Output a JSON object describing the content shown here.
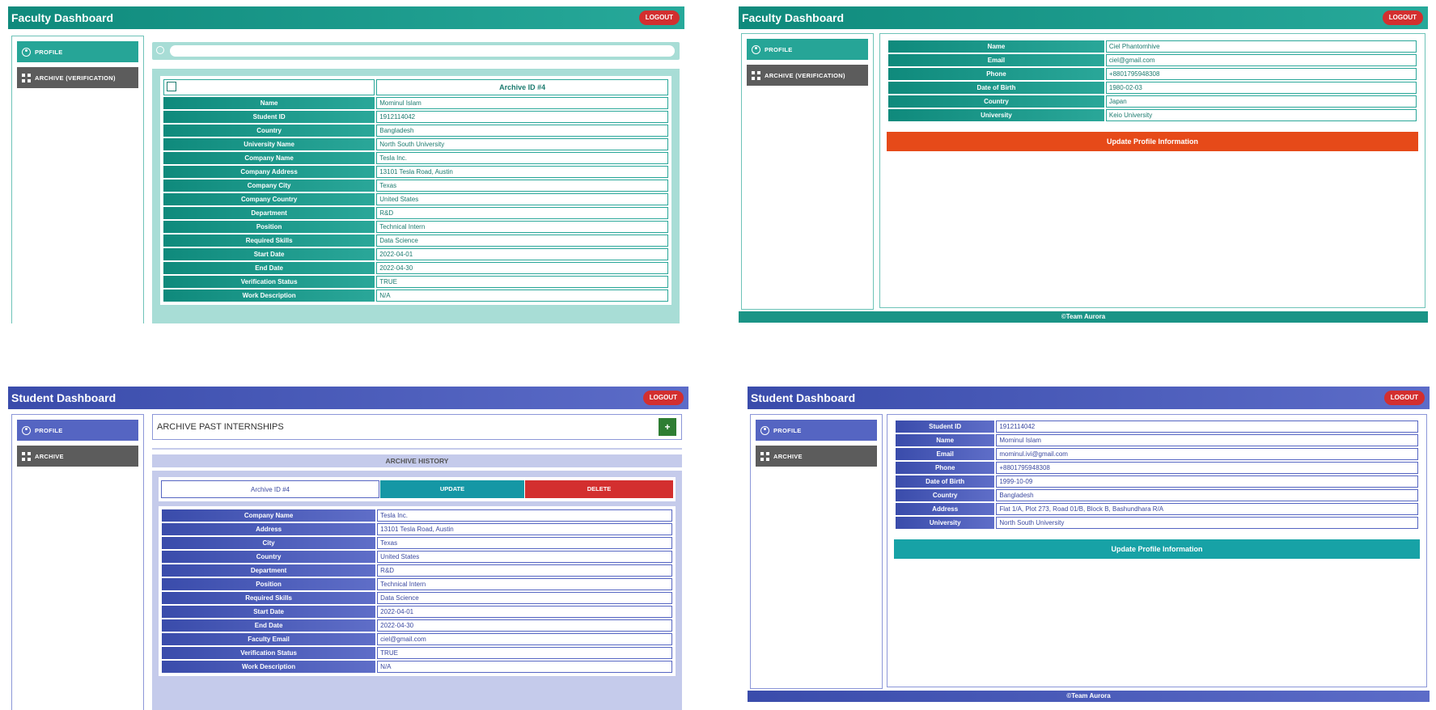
{
  "faculty_archive": {
    "title": "Faculty Dashboard",
    "logout": "LOGOUT",
    "sidebar": {
      "profile": "PROFILE",
      "archive": "ARCHIVE (VERIFICATION)"
    },
    "archive_id": "Archive ID #4",
    "rows": [
      {
        "label": "Name",
        "value": "Mominul Islam"
      },
      {
        "label": "Student ID",
        "value": "1912114042"
      },
      {
        "label": "Country",
        "value": "Bangladesh"
      },
      {
        "label": "University Name",
        "value": "North South University"
      },
      {
        "label": "Company Name",
        "value": "Tesla Inc."
      },
      {
        "label": "Company Address",
        "value": "13101 Tesla Road, Austin"
      },
      {
        "label": "Company City",
        "value": "Texas"
      },
      {
        "label": "Company Country",
        "value": "United States"
      },
      {
        "label": "Department",
        "value": "R&D"
      },
      {
        "label": "Position",
        "value": "Technical Intern"
      },
      {
        "label": "Required Skills",
        "value": "Data Science"
      },
      {
        "label": "Start Date",
        "value": "2022-04-01"
      },
      {
        "label": "End Date",
        "value": "2022-04-30"
      },
      {
        "label": "Verification Status",
        "value": "TRUE"
      },
      {
        "label": "Work Description",
        "value": "N/A"
      }
    ]
  },
  "faculty_profile": {
    "title": "Faculty Dashboard",
    "logout": "LOGOUT",
    "sidebar": {
      "profile": "PROFILE",
      "archive": "ARCHIVE (VERIFICATION)"
    },
    "rows": [
      {
        "label": "Name",
        "value": "Ciel Phantomhive"
      },
      {
        "label": "Email",
        "value": "ciel@gmail.com"
      },
      {
        "label": "Phone",
        "value": "+8801795948308"
      },
      {
        "label": "Date of Birth",
        "value": "1980-02-03"
      },
      {
        "label": "Country",
        "value": "Japan"
      },
      {
        "label": "University",
        "value": "Keio University"
      }
    ],
    "update_button": "Update Profile Information",
    "footer": "©Team Aurora"
  },
  "student_archive": {
    "title": "Student Dashboard",
    "logout": "LOGOUT",
    "sidebar": {
      "profile": "PROFILE",
      "archive": "ARCHIVE"
    },
    "section_title": "ARCHIVE PAST INTERNSHIPS",
    "add_button": "+",
    "history_title": "ARCHIVE HISTORY",
    "archive_id": "Archive ID #4",
    "update_button": "UPDATE",
    "delete_button": "DELETE",
    "rows": [
      {
        "label": "Company Name",
        "value": "Tesla Inc."
      },
      {
        "label": "Address",
        "value": "13101 Tesla Road, Austin"
      },
      {
        "label": "City",
        "value": "Texas"
      },
      {
        "label": "Country",
        "value": "United States"
      },
      {
        "label": "Department",
        "value": "R&D"
      },
      {
        "label": "Position",
        "value": "Technical Intern"
      },
      {
        "label": "Required Skills",
        "value": "Data Science"
      },
      {
        "label": "Start Date",
        "value": "2022-04-01"
      },
      {
        "label": "End Date",
        "value": "2022-04-30"
      },
      {
        "label": "Faculty Email",
        "value": "ciel@gmail.com"
      },
      {
        "label": "Verification Status",
        "value": "TRUE"
      },
      {
        "label": "Work Description",
        "value": "N/A"
      }
    ]
  },
  "student_profile": {
    "title": "Student Dashboard",
    "logout": "LOGOUT",
    "sidebar": {
      "profile": "PROFILE",
      "archive": "ARCHIVE"
    },
    "rows": [
      {
        "label": "Student ID",
        "value": "1912114042"
      },
      {
        "label": "Name",
        "value": "Mominul Islam"
      },
      {
        "label": "Email",
        "value": "mominul.ivi@gmail.com"
      },
      {
        "label": "Phone",
        "value": "+8801795948308"
      },
      {
        "label": "Date of Birth",
        "value": "1999-10-09"
      },
      {
        "label": "Country",
        "value": "Bangladesh"
      },
      {
        "label": "Address",
        "value": "Flat 1/A, Plot 273, Road 01/B, Block B, Bashundhara R/A"
      },
      {
        "label": "University",
        "value": "North South University"
      }
    ],
    "update_button": "Update Profile Information",
    "footer": "©Team Aurora"
  },
  "colors": {
    "teal": "#1a9486",
    "blue": "#4a5bbd",
    "logout": "#d32f2f",
    "orange_update": "#e64a19",
    "teal_update": "#17a2a6",
    "gray_button": "#5c5c5c",
    "green_add": "#2e7d32"
  }
}
